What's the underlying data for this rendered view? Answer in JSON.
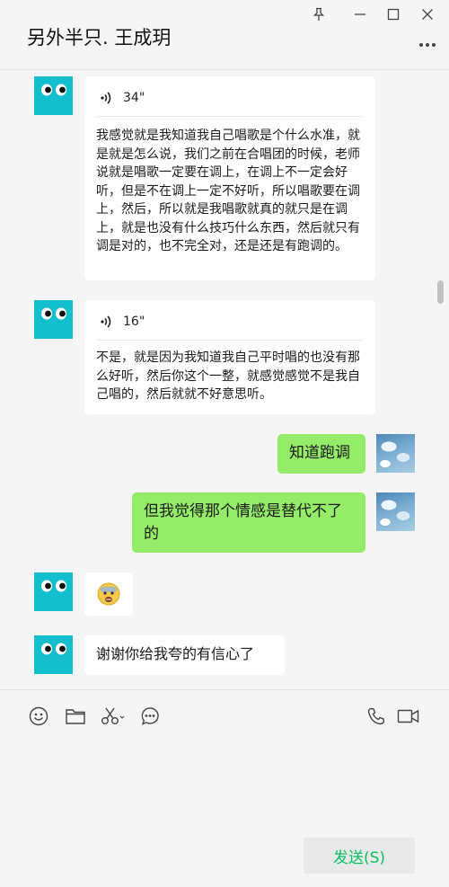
{
  "window": {
    "title": "另外半只. 王成玥",
    "controls": [
      "pin-icon",
      "minimize-icon",
      "maximize-icon",
      "close-icon"
    ]
  },
  "messages": [
    {
      "side": "left",
      "type": "voice",
      "duration": "34\"",
      "transcript": "我感觉就是我知道我自己唱歌是个什么水准，就是就是怎么说，我们之前在合唱团的时候，老师说就是唱歌一定要在调上，在调上不一定会好听，但是不在调上一定不好听，所以唱歌要在调上，然后，所以就是我唱歌就真的就只是在调上，就是也没有什么技巧什么东西，然后就只有调是对的，也不完全对，还是还是有跑调的。"
    },
    {
      "side": "left",
      "type": "voice",
      "duration": "16\"",
      "transcript": "不是，就是因为我知道我自己平时唱的也没有那么好听，然后你这个一整，就感觉感觉不是我自己唱的，然后就就不好意思听。"
    },
    {
      "side": "right",
      "type": "text",
      "text": "知道跑调"
    },
    {
      "side": "right",
      "type": "text",
      "text": "但我觉得那个情感是替代不了的"
    },
    {
      "side": "left",
      "type": "emoji",
      "text": "😨"
    },
    {
      "side": "left",
      "type": "text",
      "text": "谢谢你给我夸的有信心了"
    }
  ],
  "toolbar": {
    "left": [
      "emoji-icon",
      "folder-icon",
      "scissors-icon",
      "chat-bubble-icon"
    ],
    "right": [
      "phone-icon",
      "video-call-icon"
    ]
  },
  "send_label": "发送(S)",
  "colors": {
    "background": "#f5f5f5",
    "self_bubble": "#95ec69",
    "other_bubble": "#ffffff",
    "avatar_other": "#14bfcd",
    "send_text": "#07c160"
  }
}
